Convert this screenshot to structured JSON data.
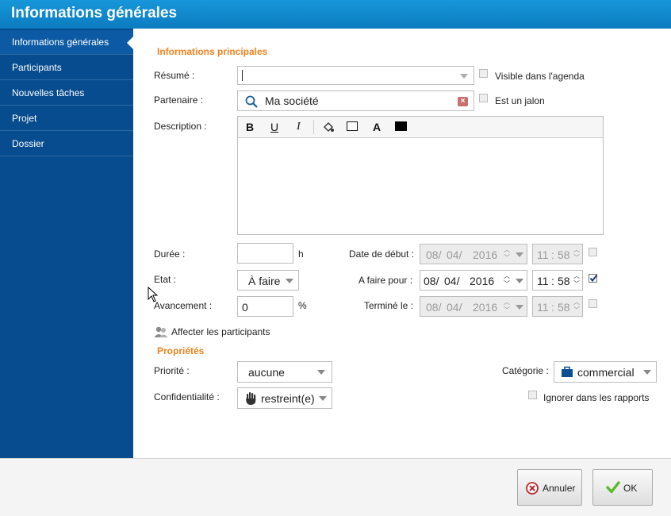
{
  "window": {
    "title": "Informations générales"
  },
  "sidebar": {
    "items": [
      {
        "label": "Informations générales"
      },
      {
        "label": "Participants"
      },
      {
        "label": "Nouvelles tâches"
      },
      {
        "label": "Projet"
      },
      {
        "label": "Dossier"
      }
    ]
  },
  "form": {
    "section_main": "Informations principales",
    "resume_label": "Résumé :",
    "resume_value": "",
    "visible_agenda_label": "Visible dans l'agenda",
    "partenaire_label": "Partenaire :",
    "partenaire_value": "Ma société",
    "jalon_label": "Est un jalon",
    "description_label": "Description :",
    "toolbar": {
      "bold": "B",
      "underline": "U",
      "italic": "I",
      "font": "A"
    },
    "duree_label": "Durée :",
    "duree_value": "",
    "duree_unit": "h",
    "etat_label": "Etat :",
    "etat_value": "À faire",
    "avancement_label": "Avancement :",
    "avancement_value": "0",
    "avancement_unit": "%",
    "date_debut_label": "Date de début :",
    "date_debut": {
      "day": "08/",
      "month": "04/",
      "year": "2016",
      "hour": "11",
      "sep": ":",
      "minute": "58"
    },
    "afaire_label": "A faire pour :",
    "afaire": {
      "day": "08/",
      "month": "04/",
      "year": "2016",
      "hour": "11",
      "sep": ":",
      "minute": "58"
    },
    "termine_label": "Terminé le :",
    "termine": {
      "day": "08/",
      "month": "04/",
      "year": "2016",
      "hour": "11",
      "sep": ":",
      "minute": "58"
    },
    "affecter_label": "Affecter les participants",
    "section_props": "Propriétés",
    "priorite_label": "Priorité :",
    "priorite_value": "aucune",
    "confidentialite_label": "Confidentialité :",
    "confidentialite_value": "restreint(e)",
    "categorie_label": "Catégorie :",
    "categorie_value": "commercial",
    "ignorer_label": "Ignorer dans les rapports"
  },
  "footer": {
    "cancel_label": "Annuler",
    "ok_label": "OK"
  },
  "colors": {
    "accent": "#0b7cc0",
    "sidebar": "#074c8f",
    "section": "#f0821e"
  }
}
